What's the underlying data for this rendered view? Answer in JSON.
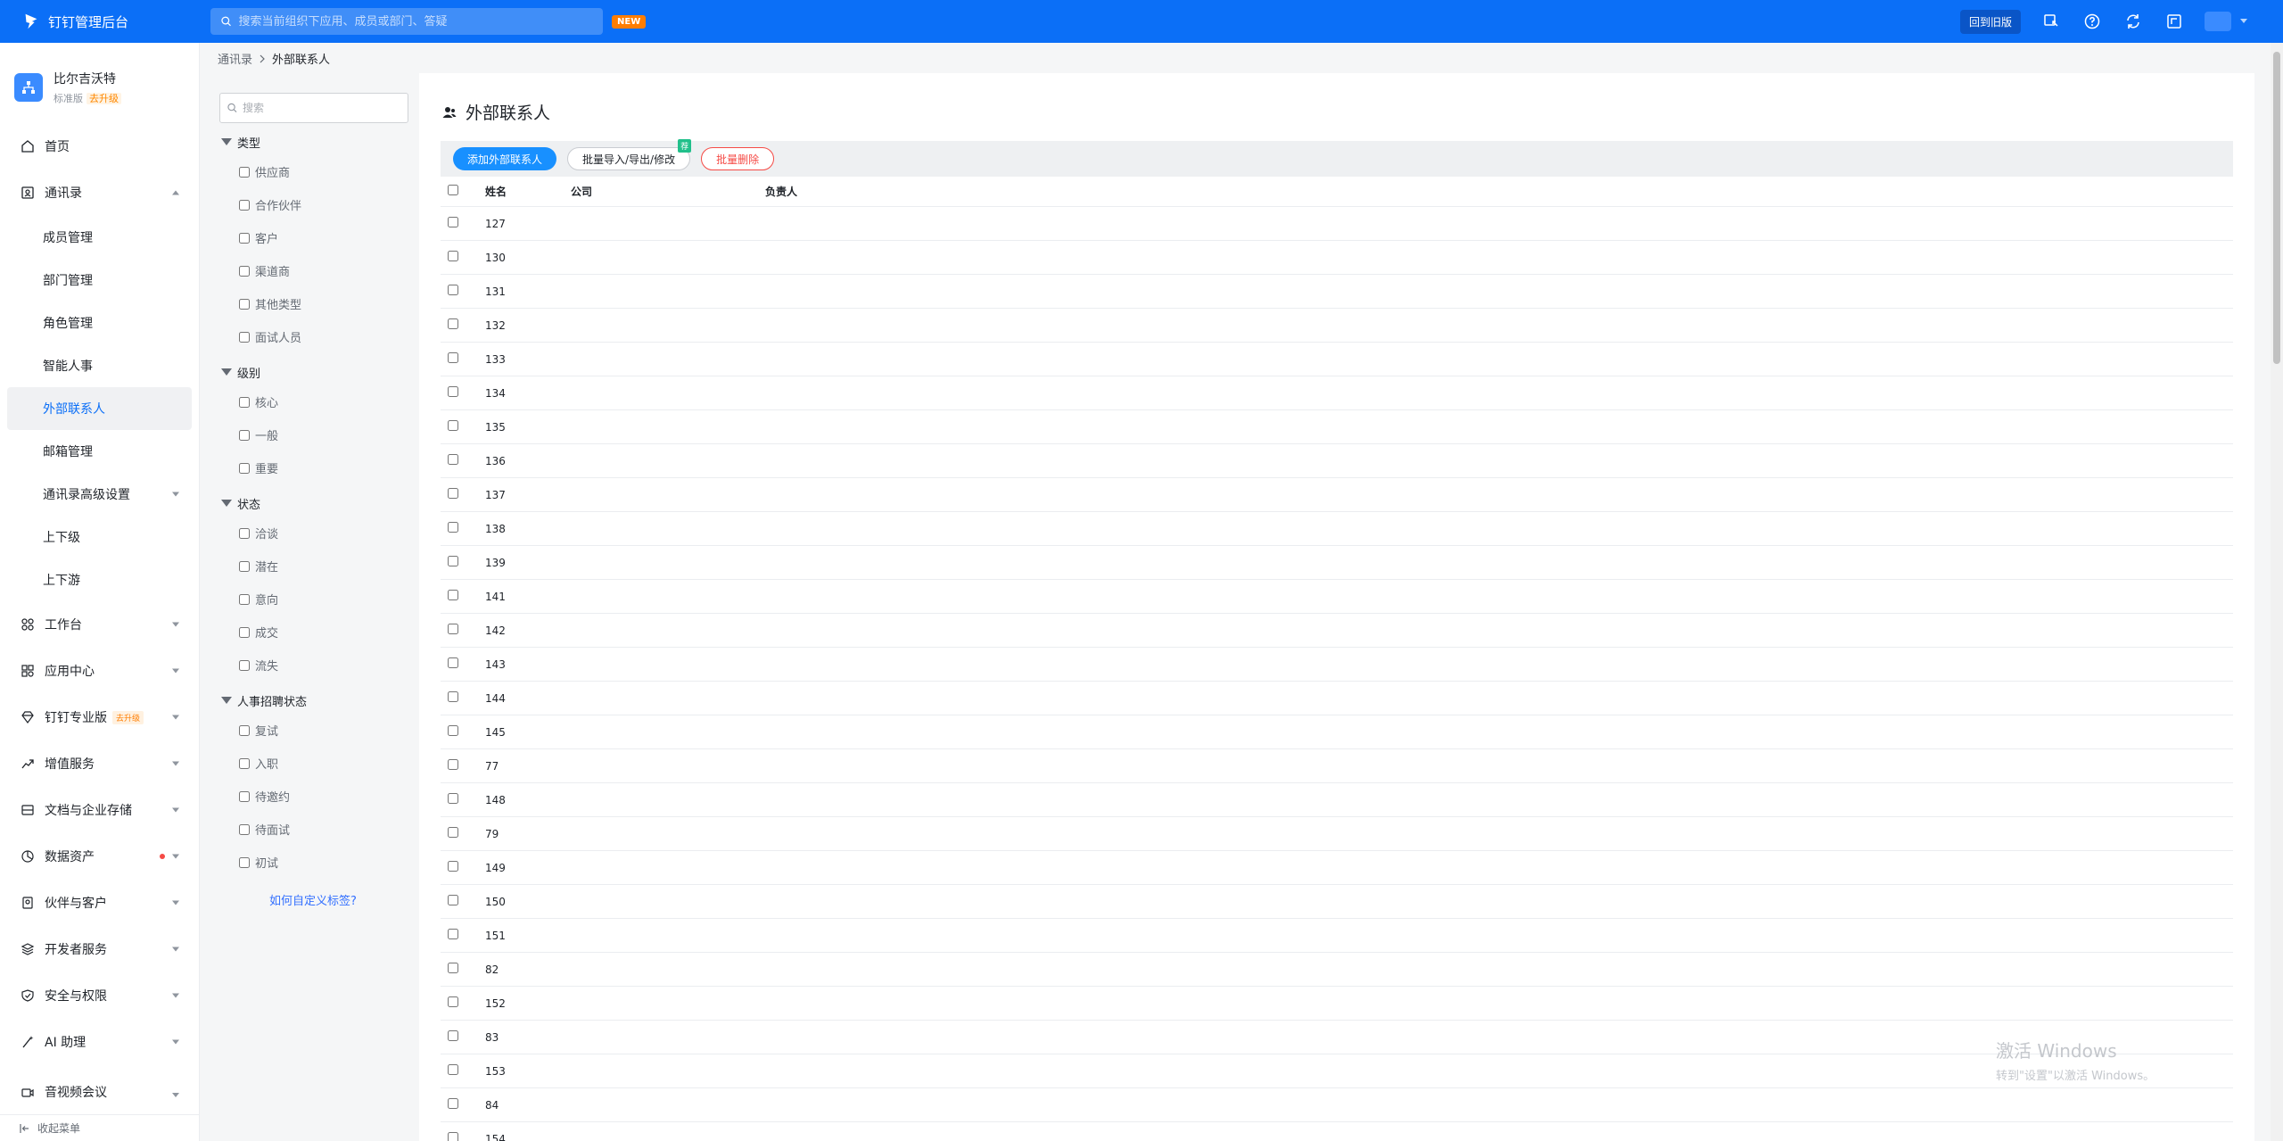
{
  "topbar": {
    "app_title": "钉钉管理后台",
    "search_placeholder": "搜索当前组织下应用、成员或部门、答疑",
    "new_badge": "NEW",
    "old_version_label": "回到旧版"
  },
  "org": {
    "name": "比尔吉沃特",
    "edition": "标准版",
    "upgrade": "去升级"
  },
  "nav": {
    "home": "首页",
    "contacts": "通讯录",
    "contacts_sub": {
      "members": "成员管理",
      "departments": "部门管理",
      "roles": "角色管理",
      "smart_hr": "智能人事",
      "external": "外部联系人",
      "mailbox": "邮箱管理",
      "advanced": "通讯录高级设置",
      "superior": "上下级",
      "upstream": "上下游"
    },
    "workbench": "工作台",
    "app_center": "应用中心",
    "pro": "钉钉专业版",
    "pro_tag": "去升级",
    "value_added": "增值服务",
    "docs_storage": "文档与企业存储",
    "data_assets": "数据资产",
    "partners": "伙伴与客户",
    "developer": "开发者服务",
    "security": "安全与权限",
    "ai": "AI 助理",
    "av_meeting": "音视频会议",
    "collapse": "收起菜单"
  },
  "breadcrumb": {
    "root": "通讯录",
    "current": "外部联系人"
  },
  "filter": {
    "search_placeholder": "搜索",
    "groups": [
      {
        "title": "类型",
        "options": [
          "供应商",
          "合作伙伴",
          "客户",
          "渠道商",
          "其他类型",
          "面试人员"
        ]
      },
      {
        "title": "级别",
        "options": [
          "核心",
          "一般",
          "重要"
        ]
      },
      {
        "title": "状态",
        "options": [
          "洽谈",
          "潜在",
          "意向",
          "成交",
          "流失"
        ]
      },
      {
        "title": "人事招聘状态",
        "options": [
          "复试",
          "入职",
          "待邀约",
          "待面试",
          "初试"
        ]
      }
    ],
    "help_link": "如何自定义标签?"
  },
  "main": {
    "title": "外部联系人",
    "add_button": "添加外部联系人",
    "batch_button": "批量导入/导出/修改",
    "batch_badge": "荐",
    "delete_button": "批量删除",
    "columns": {
      "name": "姓名",
      "company": "公司",
      "owner": "负责人"
    },
    "rows": [
      "127",
      "130",
      "131",
      "132",
      "133",
      "134",
      "135",
      "136",
      "137",
      "138",
      "139",
      "141",
      "142",
      "143",
      "144",
      "145",
      "77",
      "148",
      "79",
      "149",
      "150",
      "151",
      "82",
      "152",
      "83",
      "153",
      "84",
      "154"
    ]
  },
  "watermark": {
    "title": "激活 Windows",
    "sub": "转到\"设置\"以激活 Windows。"
  },
  "colors": {
    "topbar": "#0b6ff7",
    "primary_button": "#1890ff",
    "danger": "#f54a45",
    "active_nav": "#0b6ff7"
  }
}
